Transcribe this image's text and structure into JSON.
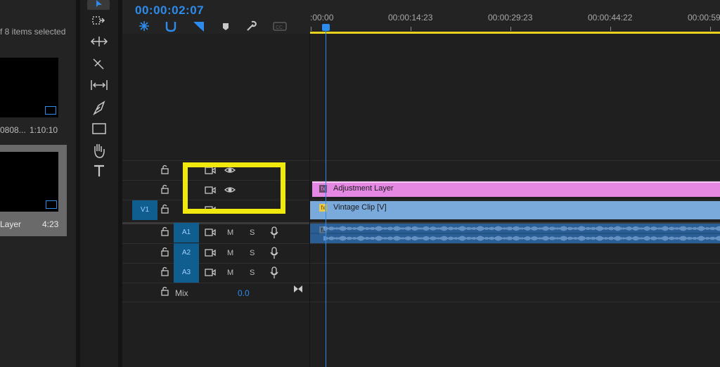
{
  "project_panel": {
    "selection_text": "f 8 items selected",
    "items": [
      {
        "name": "0808...",
        "duration": "1:10:10"
      },
      {
        "name": "Layer",
        "duration": "4:23"
      }
    ]
  },
  "tools": [
    "selection-tool",
    "track-select-forward-tool",
    "ripple-edit-tool",
    "razor-tool",
    "slip-tool",
    "pen-tool",
    "rectangle-tool",
    "hand-tool",
    "type-tool"
  ],
  "timeline": {
    "timecode": "00:00:02:07",
    "ruler_labels": [
      ":00:00",
      "00:00:14:23",
      "00:00:29:23",
      "00:00:44:22",
      "00:00:59"
    ],
    "video_tracks": [
      {
        "label": ""
      },
      {
        "label": ""
      },
      {
        "label": "V1"
      }
    ],
    "audio_tracks": [
      {
        "label": "A1",
        "mute": "M",
        "solo": "S"
      },
      {
        "label": "A2",
        "mute": "M",
        "solo": "S"
      },
      {
        "label": "A3",
        "mute": "M",
        "solo": "S"
      }
    ],
    "mix": {
      "label": "Mix",
      "value": "0.0"
    },
    "clips": {
      "adjustment": "Adjustment Layer",
      "vintage": "Vintage Clip [V]",
      "fx_badge": "fx"
    }
  },
  "colors": {
    "accent": "#2d8ceb",
    "highlight": "#f1e80e",
    "adjustment_clip": "#e588e3",
    "video_clip": "#7aa9dc",
    "audio_clip": "#2a5e94"
  }
}
